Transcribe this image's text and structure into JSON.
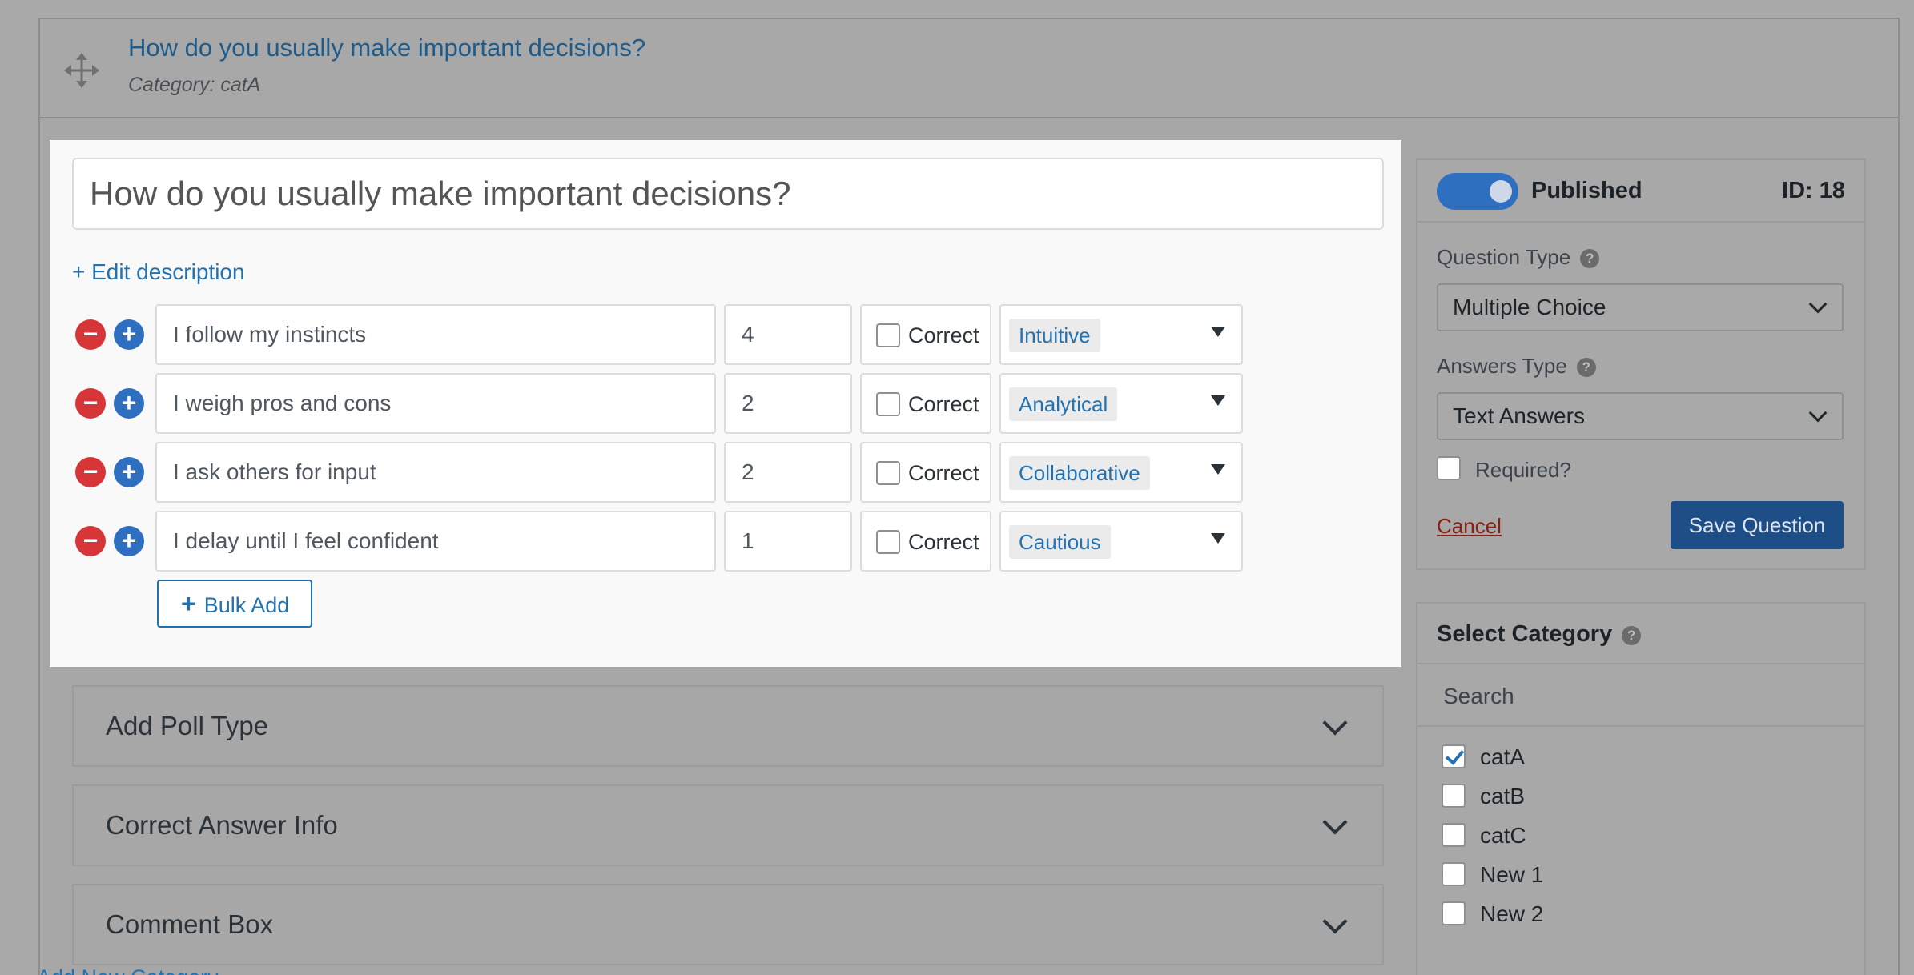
{
  "question": {
    "title": "How do you usually make important decisions?",
    "category_line": "Category: catA",
    "edit_description": "+ Edit description"
  },
  "answers": [
    {
      "text": "I follow my instincts",
      "points": "4",
      "correct_label": "Correct",
      "correct": false,
      "type": "Intuitive"
    },
    {
      "text": "I weigh pros and cons",
      "points": "2",
      "correct_label": "Correct",
      "correct": false,
      "type": "Analytical"
    },
    {
      "text": "I ask others for input",
      "points": "2",
      "correct_label": "Correct",
      "correct": false,
      "type": "Collaborative"
    },
    {
      "text": "I delay until I feel confident",
      "points": "1",
      "correct_label": "Correct",
      "correct": false,
      "type": "Cautious"
    }
  ],
  "answer_controls": {
    "remove_symbol": "−",
    "add_symbol": "+"
  },
  "bulk_add": {
    "icon": "+",
    "label": "Bulk Add"
  },
  "accordions": [
    {
      "label": "Add Poll Type"
    },
    {
      "label": "Correct Answer Info"
    },
    {
      "label": "Comment Box"
    }
  ],
  "publish": {
    "status": "Published",
    "id_label": "ID: 18",
    "question_type_label": "Question Type",
    "question_type_value": "Multiple Choice",
    "answers_type_label": "Answers Type",
    "answers_type_value": "Text Answers",
    "required_label": "Required?",
    "cancel_label": "Cancel",
    "save_label": "Save Question",
    "help_symbol": "?"
  },
  "category_box": {
    "title": "Select Category",
    "search_label": "Search",
    "items": [
      {
        "label": "catA",
        "checked": true
      },
      {
        "label": "catB",
        "checked": false
      },
      {
        "label": "catC",
        "checked": false
      },
      {
        "label": "New 1",
        "checked": false
      },
      {
        "label": "New 2",
        "checked": false
      }
    ],
    "add_new": "Add New Category"
  },
  "colors": {
    "accent": "#2271b1",
    "danger": "#d63638",
    "primary_button": "#1e4e88"
  }
}
